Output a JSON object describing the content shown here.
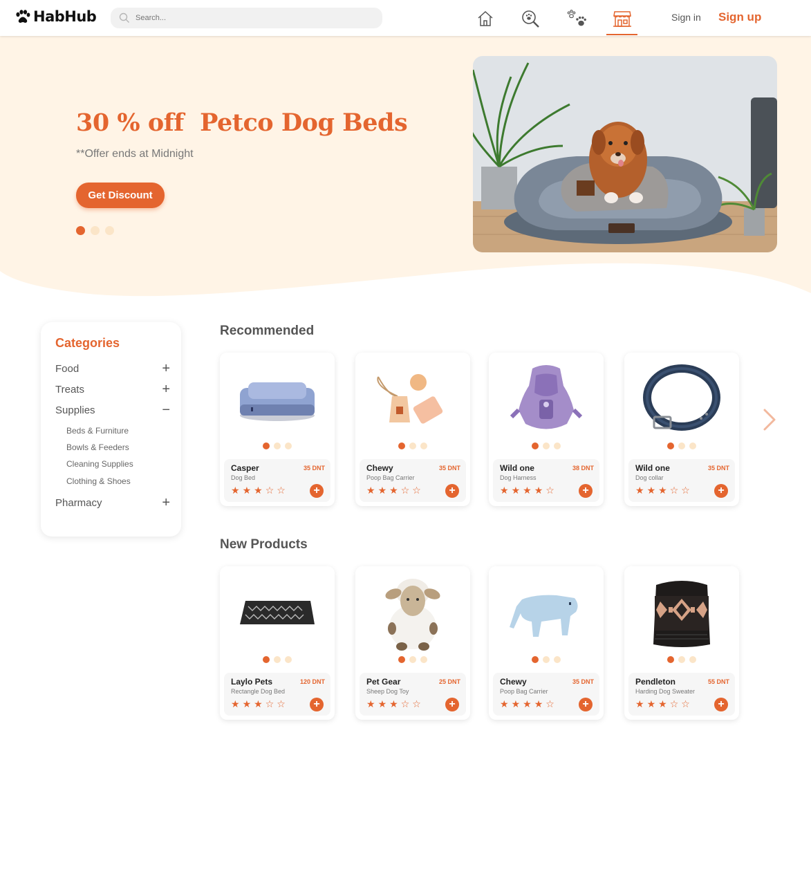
{
  "header": {
    "logo_text": "HabHub",
    "search_placeholder": "Search...",
    "nav_icons": [
      "home-icon",
      "search-paw-icon",
      "paws-icon",
      "shop-icon"
    ],
    "active_nav": "shop-icon",
    "signin_label": "Sign in",
    "signup_label": "Sign up"
  },
  "hero": {
    "title": "30 % off  Petco Dog Beds",
    "subtitle": "**Offer ends at Midnight",
    "button_label": "Get Discount",
    "slide_count": 3,
    "active_slide": 1
  },
  "categories": {
    "title": "Categories",
    "items": [
      {
        "label": "Food",
        "toggle": "+"
      },
      {
        "label": "Treats",
        "toggle": "+"
      },
      {
        "label": "Supplies",
        "toggle": "−"
      },
      {
        "label": "Pharmacy",
        "toggle": "+"
      }
    ],
    "supplies_sub": [
      "Beds & Furniture",
      "Bowls & Feeders",
      "Cleaning Supplies",
      "Clothing & Shoes"
    ]
  },
  "recommended": {
    "title": "Recommended",
    "products": [
      {
        "name": "Casper",
        "desc": "Dog Bed",
        "price": "35 DNT",
        "rating": 3,
        "image": "dog-bed-blue"
      },
      {
        "name": "Chewy",
        "desc": "Poop Bag Carrier",
        "price": "35 DNT",
        "rating": 3,
        "image": "poop-bag-carrier"
      },
      {
        "name": "Wild one",
        "desc": "Dog Harness",
        "price": "38 DNT",
        "rating": 4,
        "image": "purple-harness"
      },
      {
        "name": "Wild one",
        "desc": "Dog collar",
        "price": "35 DNT",
        "rating": 3,
        "image": "navy-collar"
      }
    ]
  },
  "new_products": {
    "title": "New Products",
    "products": [
      {
        "name": "Laylo Pets",
        "desc": "Rectangle Dog Bed",
        "price": "120 DNT",
        "rating": 3,
        "image": "black-mat-bed"
      },
      {
        "name": "Pet Gear",
        "desc": "Sheep Dog Toy",
        "price": "25 DNT",
        "rating": 3,
        "image": "sheep-toy"
      },
      {
        "name": "Chewy",
        "desc": "Poop Bag Carrier",
        "price": "35 DNT",
        "rating": 4,
        "image": "light-blue-sweater"
      },
      {
        "name": "Pendleton",
        "desc": "Harding Dog Sweater",
        "price": "55 DNT",
        "rating": 3,
        "image": "patterned-sweater"
      }
    ]
  },
  "colors": {
    "accent": "#e4652f",
    "hero_bg": "#fff4e6",
    "dot_inactive": "#fbe5c8"
  }
}
